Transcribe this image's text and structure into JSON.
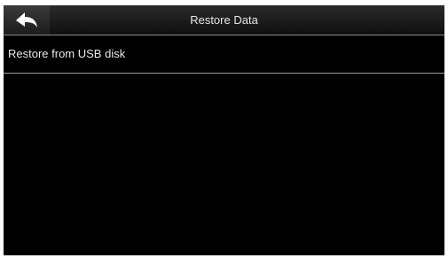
{
  "header": {
    "title": "Restore Data",
    "back_icon": "back-arrow-icon"
  },
  "menu": {
    "items": [
      {
        "label": "Restore from USB disk"
      }
    ]
  },
  "colors": {
    "background": "#000000",
    "text": "#e6e6e6",
    "divider": "#9a9a9a"
  }
}
